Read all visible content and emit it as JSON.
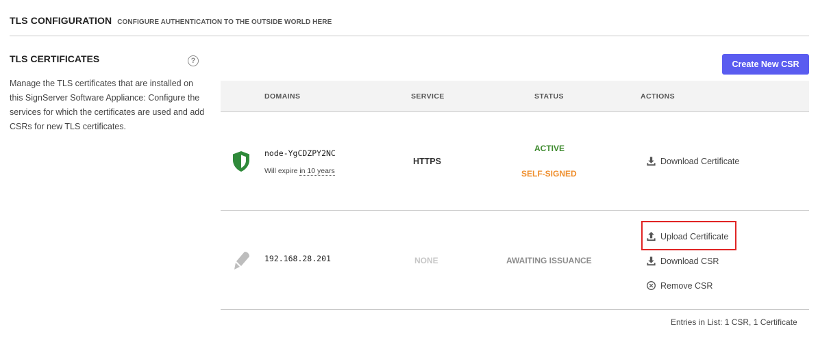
{
  "header": {
    "title": "TLS CONFIGURATION",
    "subtitle": "CONFIGURE AUTHENTICATION TO THE OUTSIDE WORLD HERE"
  },
  "side": {
    "title": "TLS CERTIFICATES",
    "help_icon": "?",
    "description": "Manage the TLS certificates that are installed on this SignServer Software Appliance: Configure the services for which the certificates are used and add CSRs for new TLS certificates."
  },
  "toolbar": {
    "create_csr_label": "Create New CSR"
  },
  "table": {
    "columns": [
      "DOMAINS",
      "SERVICE",
      "STATUS",
      "ACTIONS"
    ],
    "rows": [
      {
        "icon": "shield-icon",
        "domain": "node-YgCDZPY2NC",
        "expire_prefix": "Will expire ",
        "expire_value": "in 10 years",
        "service": "HTTPS",
        "status_primary": "ACTIVE",
        "status_secondary": "SELF-SIGNED",
        "actions": [
          {
            "icon": "download-icon",
            "label": "Download Certificate"
          }
        ]
      },
      {
        "icon": "pen-icon",
        "domain": "192.168.28.201",
        "service": "NONE",
        "status_primary": "AWAITING ISSUANCE",
        "actions": [
          {
            "icon": "upload-icon",
            "label": "Upload Certificate"
          },
          {
            "icon": "download-icon",
            "label": "Download CSR"
          },
          {
            "icon": "remove-circle-icon",
            "label": "Remove CSR"
          }
        ]
      }
    ]
  },
  "footer": {
    "entries": "Entries in List: 1 CSR, 1 Certificate"
  },
  "colors": {
    "accent": "#5a5cf0",
    "active": "#3e8a2e",
    "self_signed": "#ef8f2e",
    "highlight": "#e02424"
  }
}
